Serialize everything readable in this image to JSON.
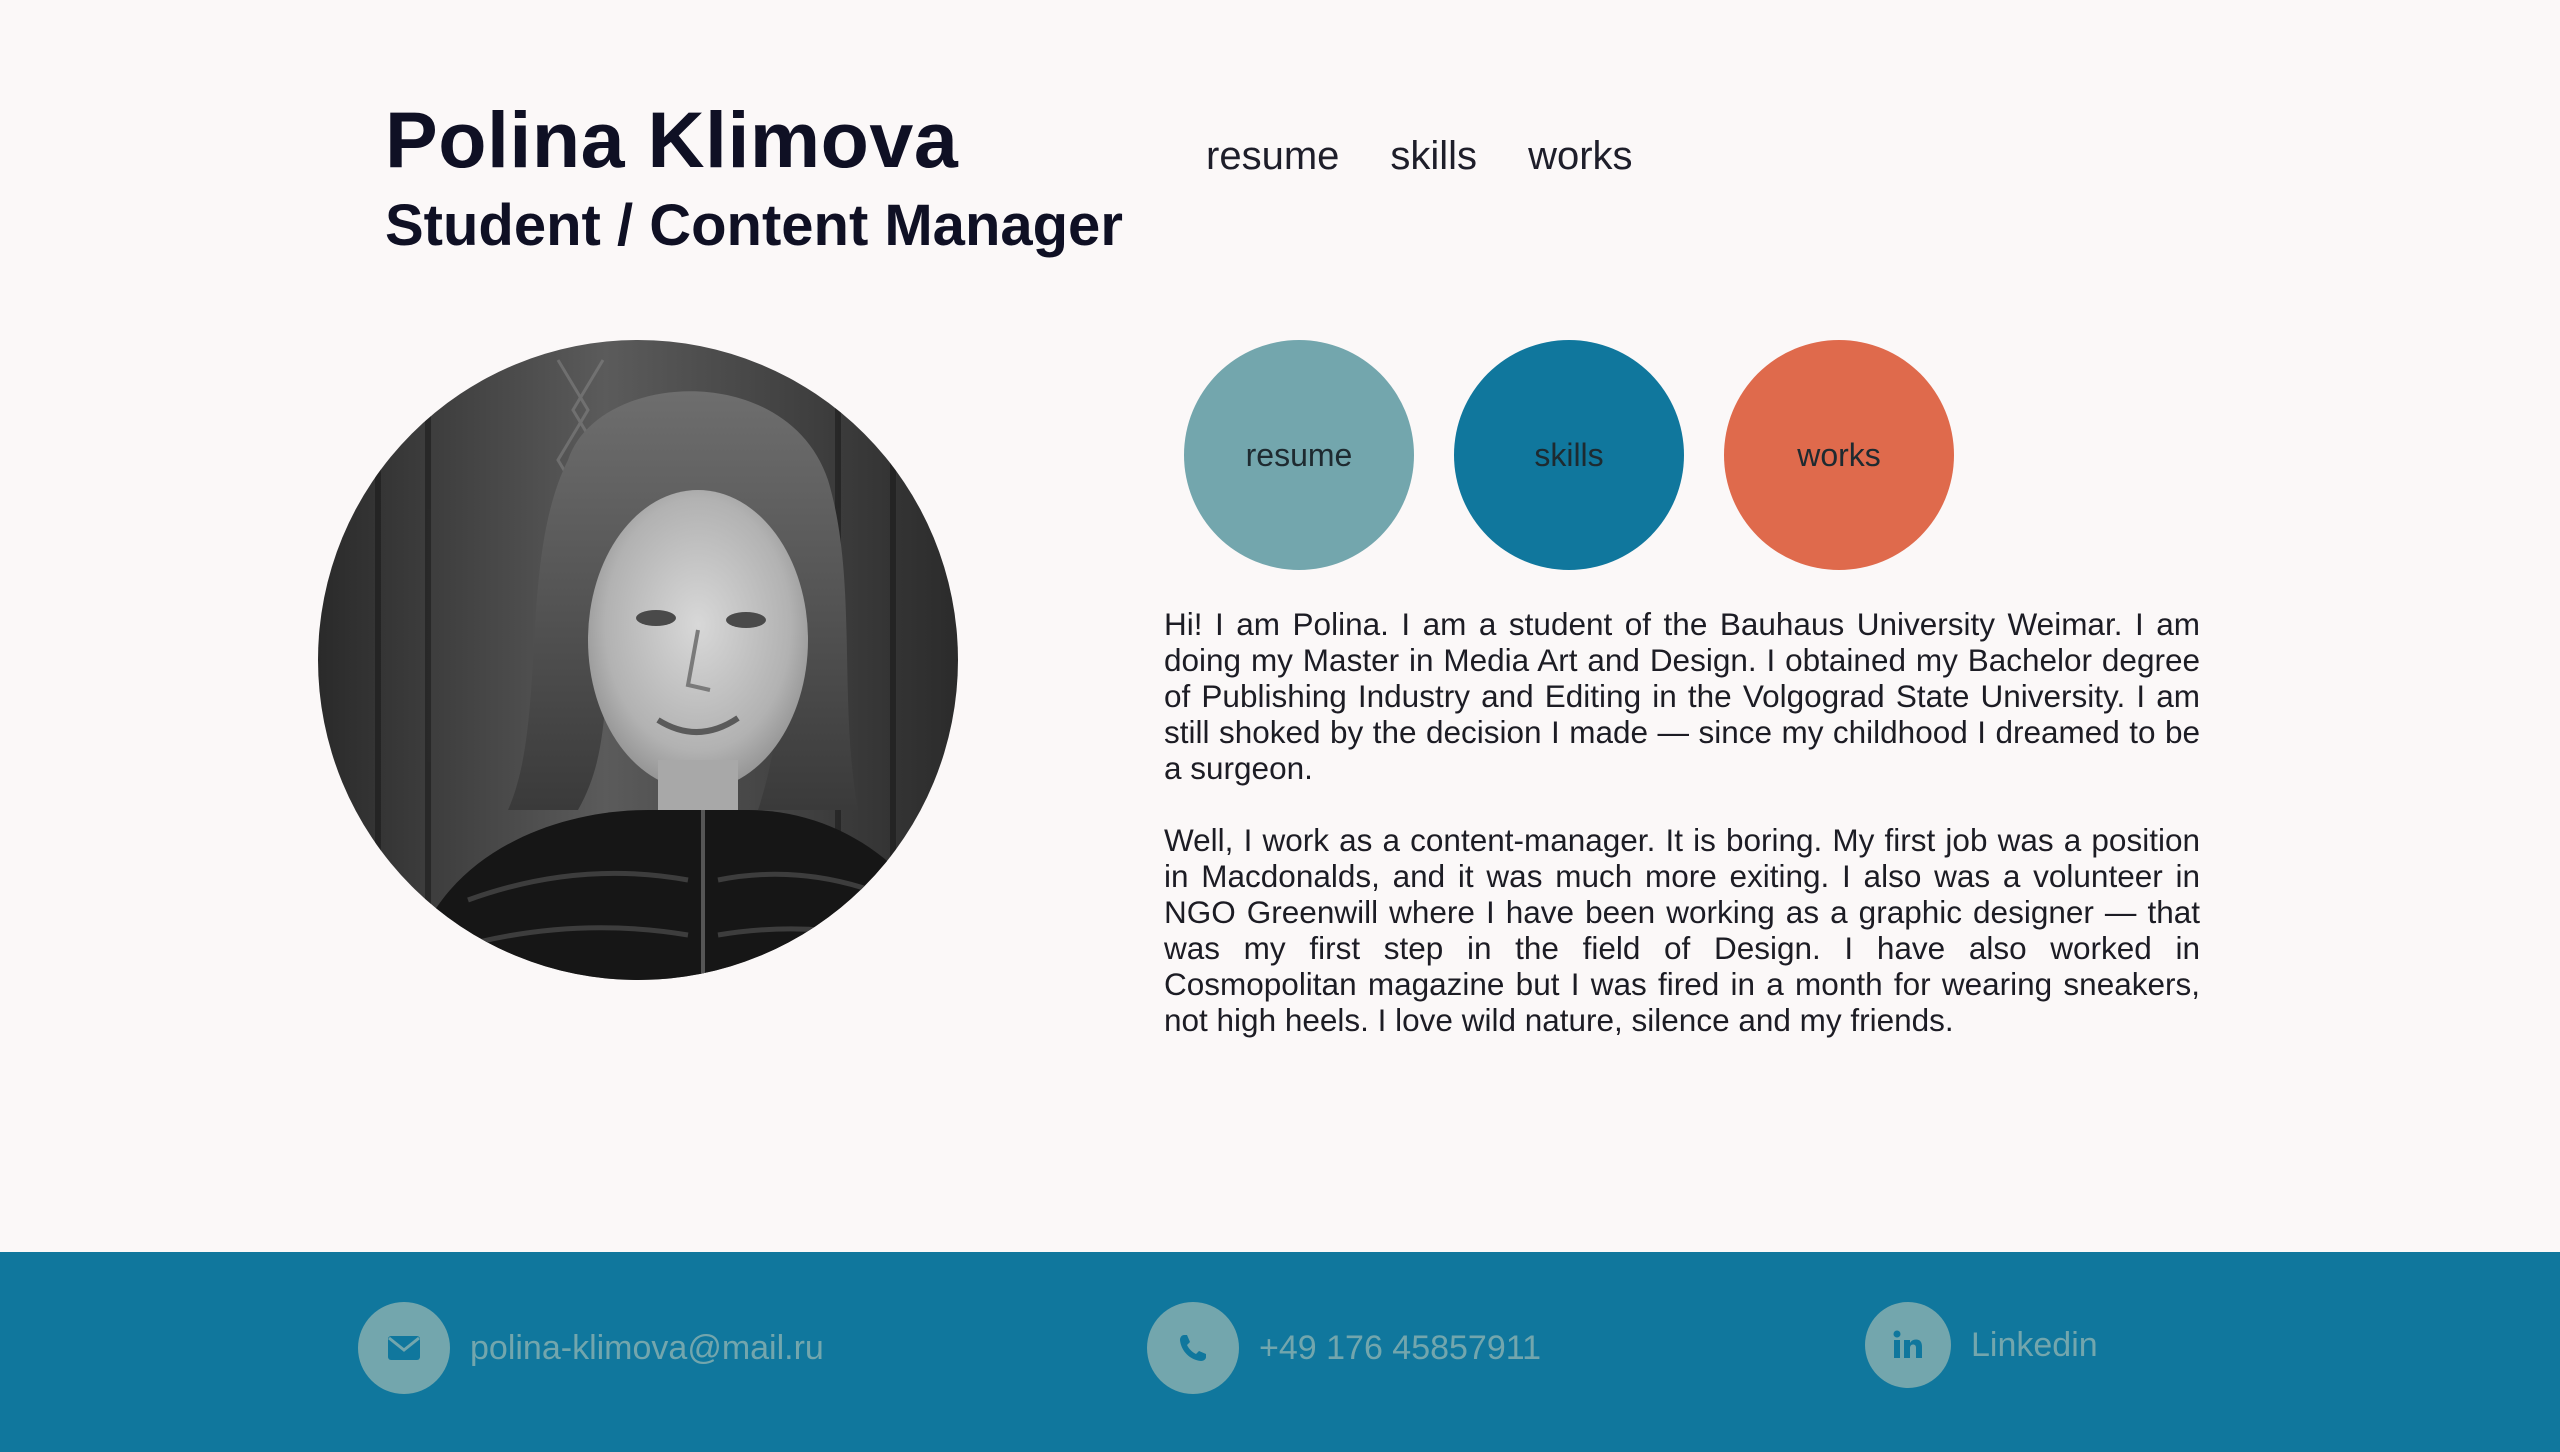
{
  "header": {
    "name": "Polina Klimova",
    "role": "Student / Content Manager"
  },
  "nav": {
    "items": [
      "resume",
      "skills",
      "works"
    ]
  },
  "profile": {
    "photo_icon": "portrait-photo"
  },
  "circles": {
    "resume": {
      "label": "resume",
      "color": "#73a6ad"
    },
    "skills": {
      "label": "skills",
      "color": "#10779d"
    },
    "works": {
      "label": "works",
      "color": "#df6a4c"
    }
  },
  "bio": {
    "paragraph_1": "Hi! I am Polina. I am a student of the Bauhaus University Weimar. I am doing my Master in Media Art and Design. I obtained my Bachelor degree of Publishing Industry and Editing in the Volgograd State University. I am still shoked by the decision I made — since my childhood I dreamed to be a surgeon.",
    "paragraph_2": "Well, I work as a content-manager. It is boring. My first job was a position in Macdonalds, and it was much more exiting. I also was a volunteer in NGO Greenwill where I have been working as a graphic designer — that was my first step in the field of Design. I have also worked in Cosmopolitan magazine but I was fired in a month for wearing sneakers, not high heels. I love wild nature, silence and my friends."
  },
  "footer": {
    "background": "#10779d",
    "icon_background": "#73a6ad",
    "email": {
      "label": "polina-klimova@mail.ru",
      "icon": "envelope-icon"
    },
    "phone": {
      "label": "+49 176 45857911",
      "icon": "phone-icon"
    },
    "linkedin": {
      "label": "Linkedin",
      "icon": "linkedin-icon"
    }
  }
}
